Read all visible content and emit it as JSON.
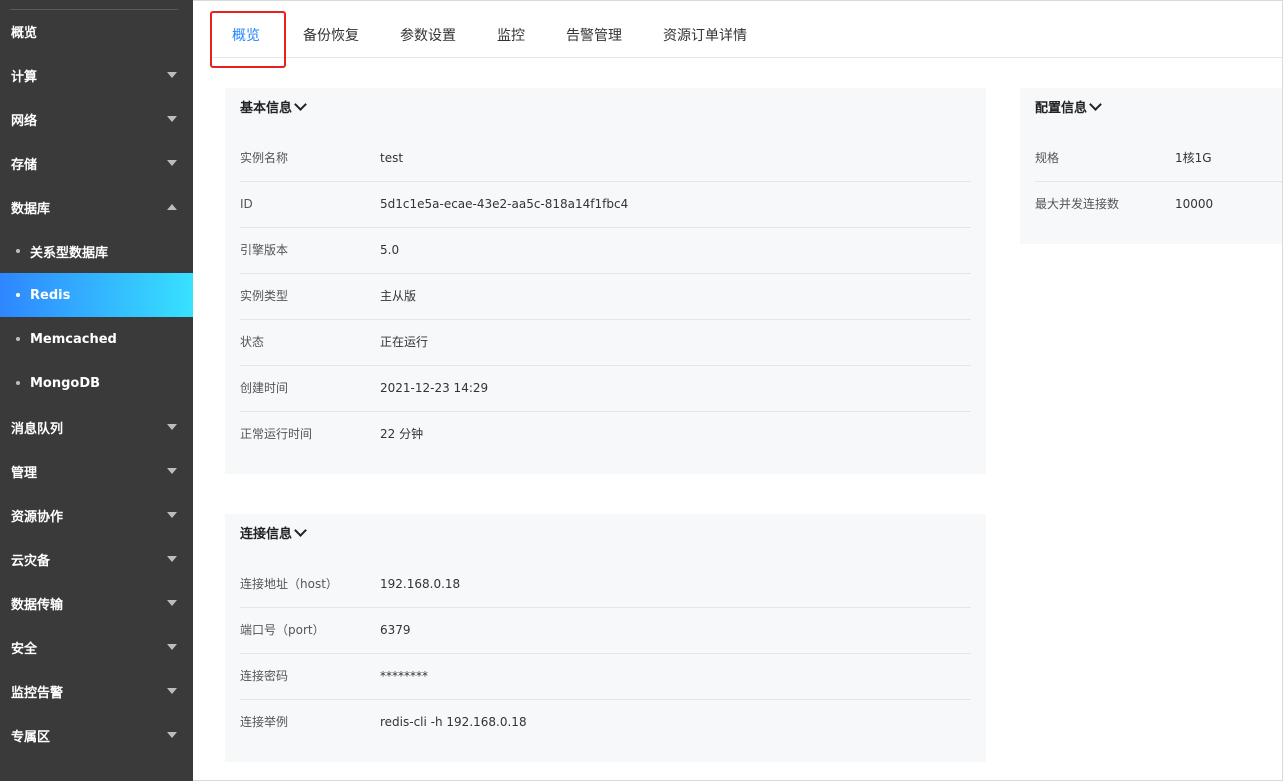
{
  "sidebar": {
    "items": [
      {
        "label": "概览"
      },
      {
        "label": "计算"
      },
      {
        "label": "网络"
      },
      {
        "label": "存储"
      },
      {
        "label": "数据库"
      },
      {
        "label": "关系型数据库"
      },
      {
        "label": "Redis"
      },
      {
        "label": "Memcached"
      },
      {
        "label": "MongoDB"
      },
      {
        "label": "消息队列"
      },
      {
        "label": "管理"
      },
      {
        "label": "资源协作"
      },
      {
        "label": "云灾备"
      },
      {
        "label": "数据传输"
      },
      {
        "label": "安全"
      },
      {
        "label": "监控告警"
      },
      {
        "label": "专属区"
      }
    ]
  },
  "tabs": [
    {
      "label": "概览"
    },
    {
      "label": "备份恢复"
    },
    {
      "label": "参数设置"
    },
    {
      "label": "监控"
    },
    {
      "label": "告警管理"
    },
    {
      "label": "资源订单详情"
    }
  ],
  "basic": {
    "title": "基本信息",
    "rows": [
      {
        "k": "实例名称",
        "v": "test"
      },
      {
        "k": "ID",
        "v": "5d1c1e5a-ecae-43e2-aa5c-818a14f1fbc4"
      },
      {
        "k": "引擎版本",
        "v": "5.0"
      },
      {
        "k": "实例类型",
        "v": "主从版"
      },
      {
        "k": "状态",
        "v": "正在运行"
      },
      {
        "k": "创建时间",
        "v": "2021-12-23 14:29"
      },
      {
        "k": "正常运行时间",
        "v": "22 分钟"
      }
    ]
  },
  "config": {
    "title": "配置信息",
    "rows": [
      {
        "k": "规格",
        "v": "1核1G"
      },
      {
        "k": "最大并发连接数",
        "v": "10000"
      }
    ]
  },
  "connection": {
    "title": "连接信息",
    "rows": [
      {
        "k": "连接地址（host）",
        "v": "192.168.0.18"
      },
      {
        "k": "端口号（port）",
        "v": "6379"
      },
      {
        "k": "连接密码",
        "v": "********"
      },
      {
        "k": "连接举例",
        "v": "redis-cli -h 192.168.0.18"
      }
    ]
  },
  "colors": {
    "accent": "#1e86ff",
    "sidebar_bg": "#3a3a3a",
    "highlight_box": "#e8211f"
  }
}
